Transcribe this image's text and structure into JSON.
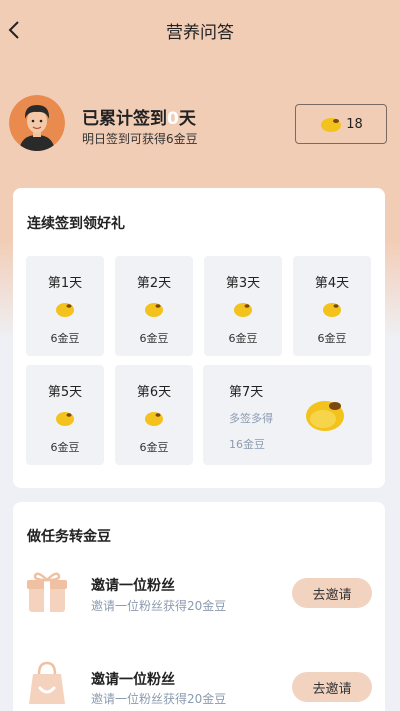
{
  "header": {
    "title": "营养问答"
  },
  "profile": {
    "sign_prefix": "已累计签到",
    "sign_days": "0",
    "sign_suffix": "天",
    "subtitle": "明日签到可获得6金豆",
    "bean_count": "18"
  },
  "checkin": {
    "title": "连续签到领好礼",
    "days": [
      {
        "label": "第1天",
        "reward": "6金豆"
      },
      {
        "label": "第2天",
        "reward": "6金豆"
      },
      {
        "label": "第3天",
        "reward": "6金豆"
      },
      {
        "label": "第4天",
        "reward": "6金豆"
      },
      {
        "label": "第5天",
        "reward": "6金豆"
      },
      {
        "label": "第6天",
        "reward": "6金豆"
      }
    ],
    "day7": {
      "label": "第7天",
      "note": "多签多得",
      "reward": "16金豆"
    }
  },
  "tasks": {
    "title": "做任务转金豆",
    "items": [
      {
        "name": "邀请一位粉丝",
        "desc": "邀请一位粉丝获得20金豆",
        "button": "去邀请"
      },
      {
        "name": "邀请一位粉丝",
        "desc": "邀请一位粉丝获得20金豆",
        "button": "去邀请"
      }
    ]
  },
  "colors": {
    "header_bg": "#f2cdb6",
    "page_bg": "#eff0f5",
    "bean": "#f3c21c",
    "accent_button": "#f2d3c0",
    "muted_text": "#8c9bb0"
  }
}
